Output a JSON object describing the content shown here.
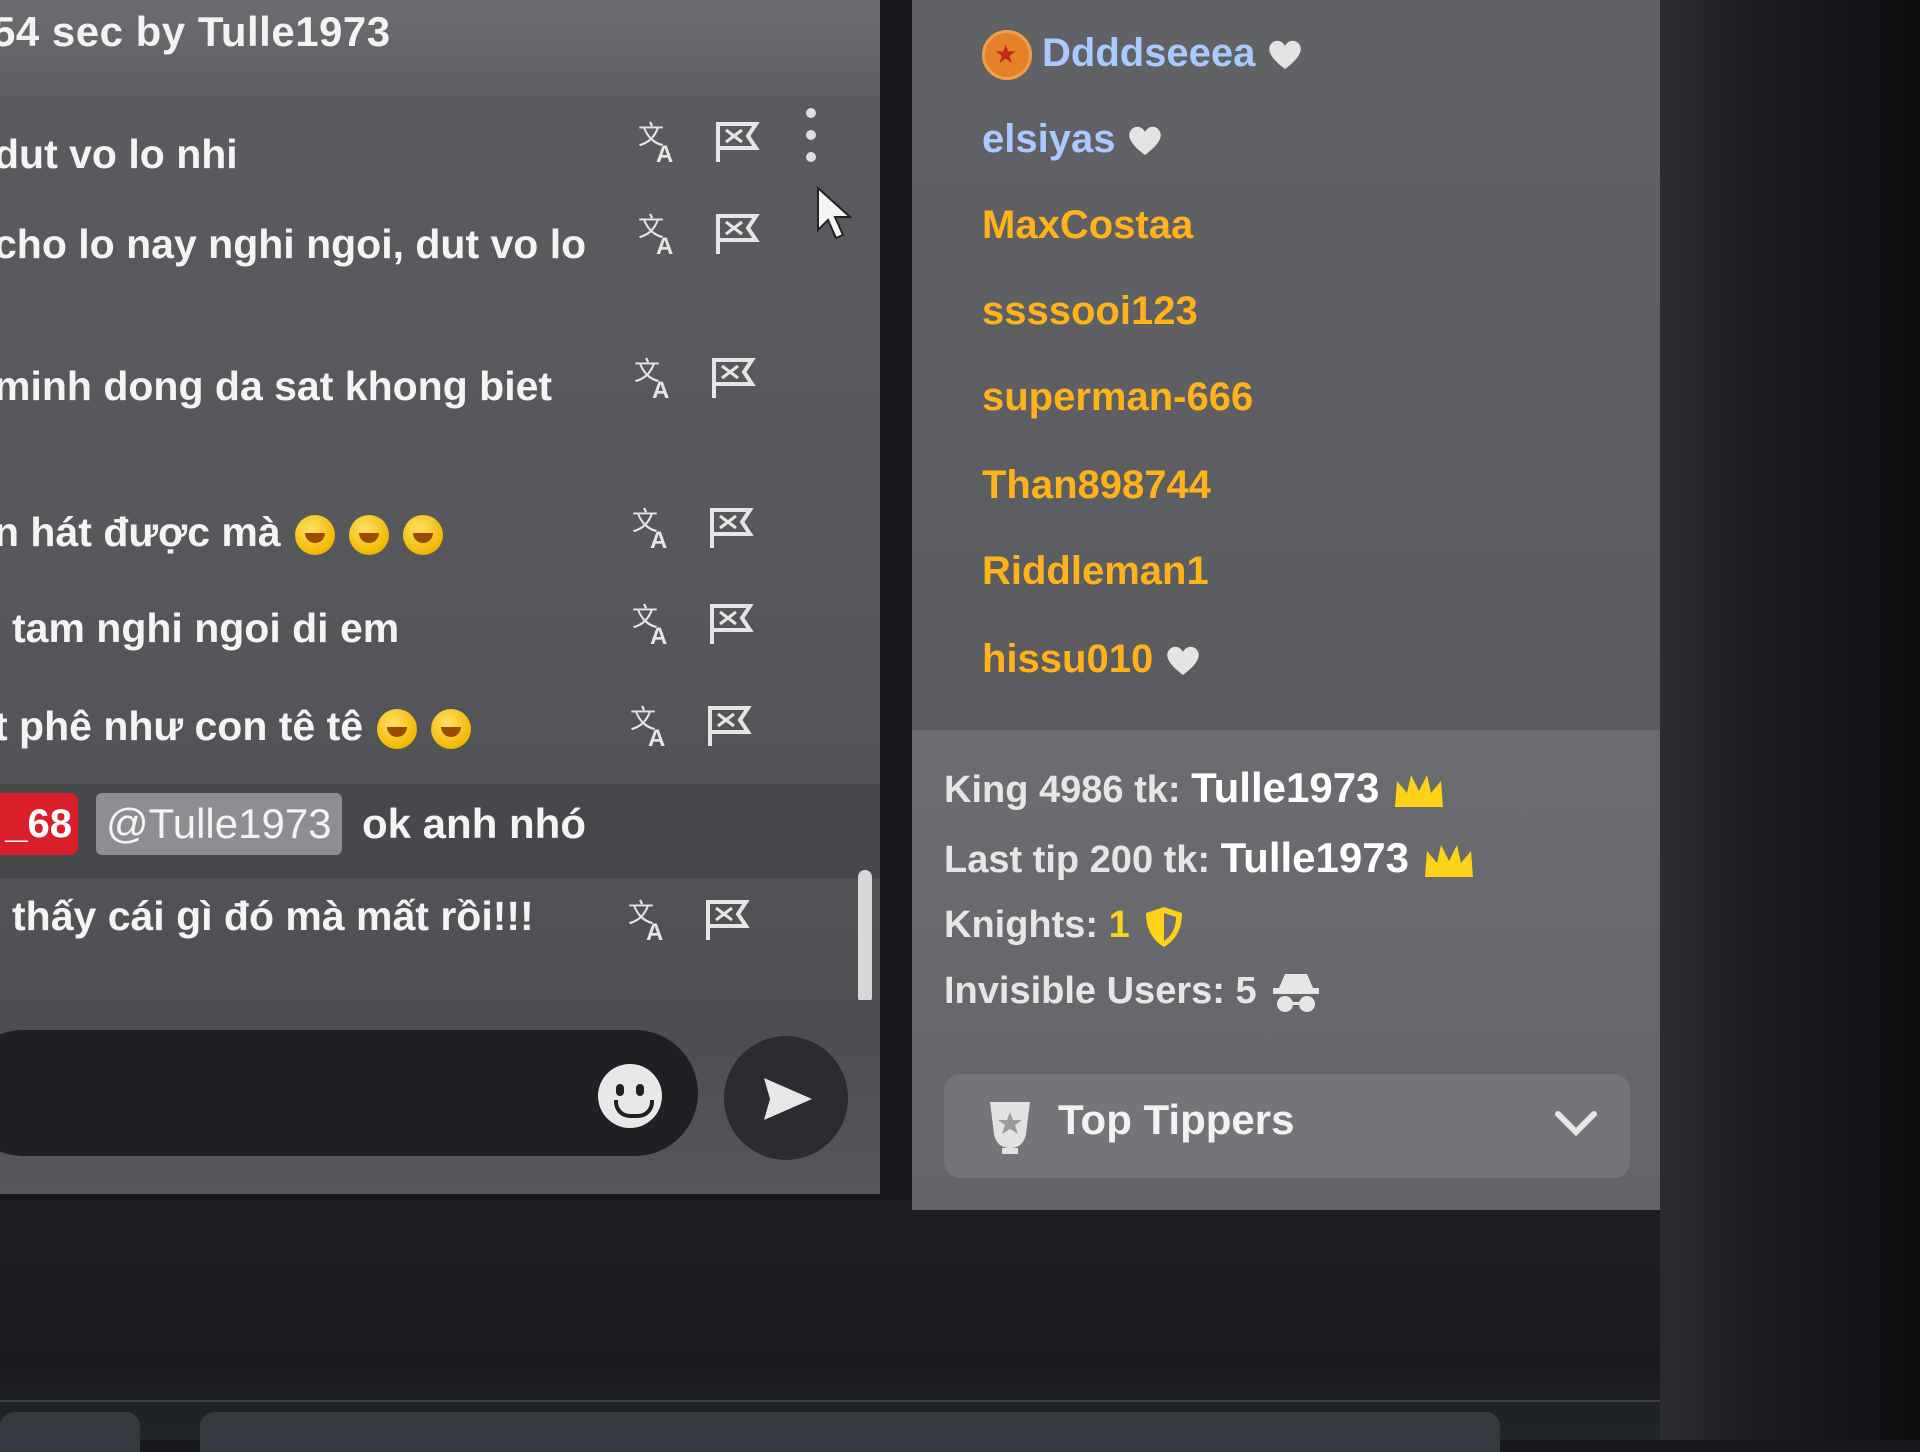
{
  "chat": {
    "header_text": "54 sec by Tulle1973",
    "messages": [
      {
        "text": "dut vo lo nhi",
        "emojis": 0
      },
      {
        "text": "cho lo nay nghi ngoi, dut vo lo",
        "emojis": 0
      },
      {
        "text": "minh dong da sat khong biet",
        "emojis": 0
      },
      {
        "text": "n hát được mà",
        "emojis": 3
      },
      {
        "text": "tam nghi ngoi di em",
        "emojis": 0
      },
      {
        "text": "t phê như con tê tê",
        "emojis": 2
      },
      {
        "text": "thấy cái gì đó mà mất rồi!!!",
        "emojis": 0
      }
    ],
    "mention_message": {
      "badge": "_68",
      "mention": "@Tulle1973",
      "text": "ok anh nhó"
    },
    "icons": {
      "translate": "translate-icon",
      "report": "report-flag-icon",
      "more": "more-options-icon",
      "emoji_picker": "smiley-icon",
      "send": "send-icon"
    }
  },
  "users_panel": {
    "users": [
      {
        "name": "Ddddseeea",
        "color": "#a9c9ff",
        "heart": true,
        "badge": "star-badge"
      },
      {
        "name": "elsiyas",
        "color": "#a9c9ff",
        "heart": true
      },
      {
        "name": "MaxCostaa",
        "color": "#ffb21a",
        "heart": false
      },
      {
        "name": "ssssooi123",
        "color": "#ffb21a",
        "heart": false
      },
      {
        "name": "superman-666",
        "color": "#ffb21a",
        "heart": false
      },
      {
        "name": "Than898744",
        "color": "#ffb21a",
        "heart": false
      },
      {
        "name": "Riddleman1",
        "color": "#ffb21a",
        "heart": false
      },
      {
        "name": "hissu010",
        "color": "#ffb21a",
        "heart": true
      }
    ],
    "stats": {
      "king_label": "King 4986 tk:",
      "king_name": "Tulle1973",
      "last_tip_label": "Last tip 200 tk:",
      "last_tip_name": "Tulle1973",
      "knights_label": "Knights:",
      "knights_value": "1",
      "invisible_label": "Invisible Users:",
      "invisible_value": "5"
    },
    "top_tippers_label": "Top Tippers",
    "accent_gold": "#ffd21a"
  }
}
